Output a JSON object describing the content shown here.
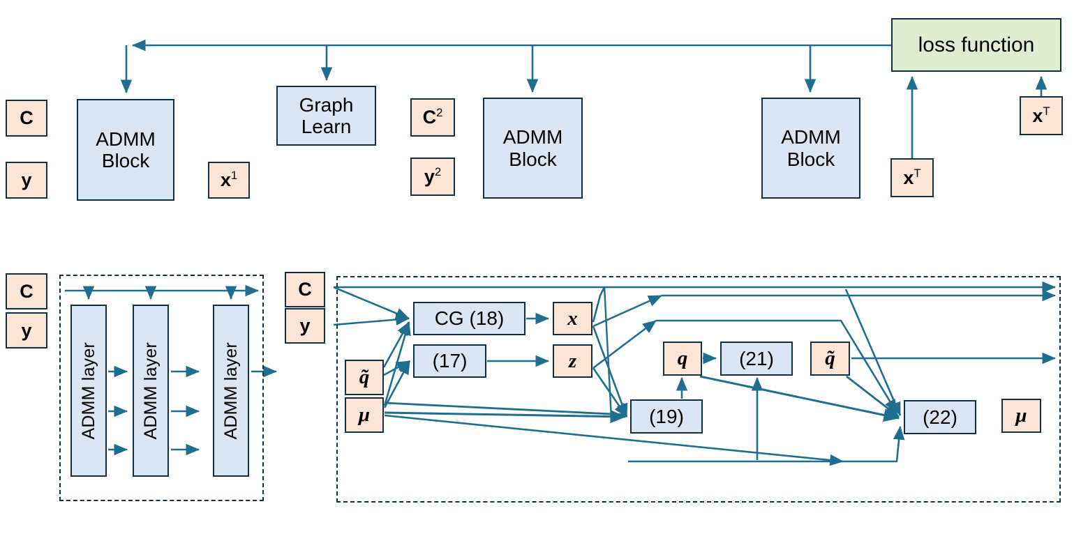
{
  "diagram": {
    "title": "ADMM unrolled network architecture diagram",
    "colors": {
      "peach": "#fce4d6",
      "blue": "#dae6f3",
      "green": "#ddeed3",
      "stroke": "#123040",
      "wire": "#1f6d8f"
    }
  },
  "top_row": {
    "input_c": "C",
    "input_y": "y",
    "admm_block_1_line1": "ADMM",
    "admm_block_1_line2": "Block",
    "x1_base": "x",
    "x1_sup": "1",
    "graph_learn_line1": "Graph",
    "graph_learn_line2": "Learn",
    "c2_base": "C",
    "c2_sup": "2",
    "y2_base": "y",
    "y2_sup": "2",
    "admm_block_2_line1": "ADMM",
    "admm_block_2_line2": "Block",
    "admm_block_3_line1": "ADMM",
    "admm_block_3_line2": "Block",
    "loss_function": "loss function",
    "xT_mid_base": "x",
    "xT_mid_sup": "T",
    "xT_right_base": "x",
    "xT_right_sup": "T"
  },
  "bottom_left": {
    "input_c": "C",
    "input_y": "y",
    "layer_1": "ADMM layer",
    "layer_2": "ADMM layer",
    "layer_3": "ADMM layer"
  },
  "bottom_right": {
    "input_c": "C",
    "input_y": "y",
    "input_qtilde": "q̃",
    "input_mu": "μ",
    "cg18": "CG (18)",
    "eq17": "(17)",
    "var_x": "x",
    "var_z": "z",
    "eq19": "(19)",
    "var_q": "q",
    "eq21": "(21)",
    "out_qtilde": "q̃",
    "eq22": "(22)",
    "out_mu": "μ"
  }
}
